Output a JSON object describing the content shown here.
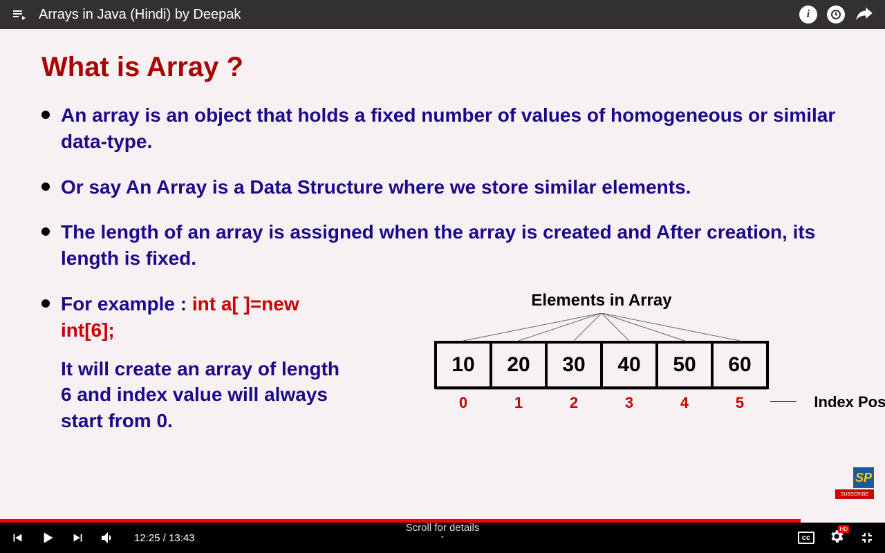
{
  "video": {
    "title": "Arrays in Java (Hindi) by Deepak",
    "current_time": "12:25",
    "duration": "13:43",
    "scroll_hint": "Scroll for details",
    "hd_label": "HD",
    "cc_label": "cc"
  },
  "slide": {
    "heading": "What is Array ?",
    "bullets": [
      "An array is an object that holds a fixed number of values of homogeneous or similar data-type.",
      "Or say An Array is a Data Structure where we store similar elements.",
      "The length of an array is assigned when the array is created and After creation, its length is fixed."
    ],
    "example_prefix": "For example : ",
    "example_code": "int a[ ]=new int[6];",
    "example_desc": "It will create an array of length 6 and index value will always start from 0.",
    "diagram_title": "Elements in Array",
    "array_values": [
      "10",
      "20",
      "30",
      "40",
      "50",
      "60"
    ],
    "array_indices": [
      "0",
      "1",
      "2",
      "3",
      "4",
      "5"
    ],
    "index_label": "Index Positions"
  },
  "watermark": {
    "logo": "SP",
    "subscribe": "SUBSCRIBE"
  }
}
